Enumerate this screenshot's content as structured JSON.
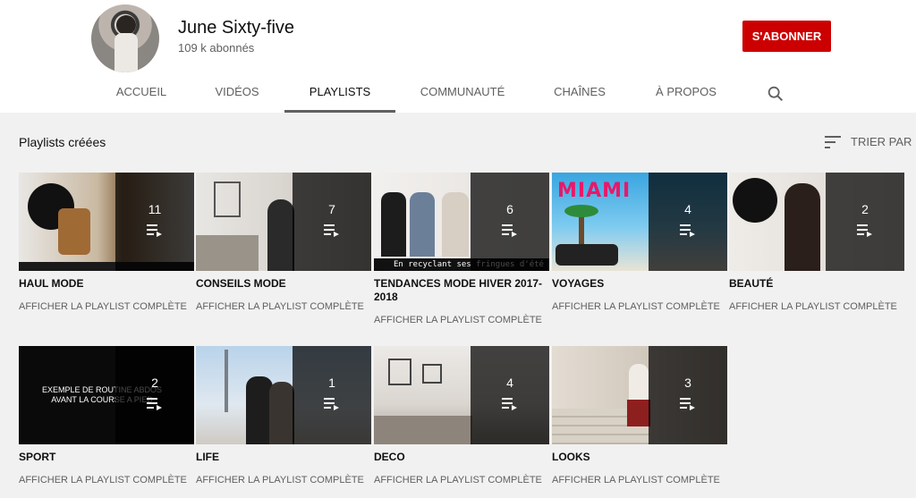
{
  "channel": {
    "name": "June Sixty-five",
    "subscribers": "109 k abonnés",
    "subscribe_label": "S'ABONNER"
  },
  "tabs": [
    {
      "label": "ACCUEIL"
    },
    {
      "label": "VIDÉOS"
    },
    {
      "label": "PLAYLISTS"
    },
    {
      "label": "COMMUNAUTÉ"
    },
    {
      "label": "CHAÎNES"
    },
    {
      "label": "À PROPOS"
    }
  ],
  "active_tab": "PLAYLISTS",
  "section": {
    "title": "Playlists créées",
    "sort_label": "TRIER PAR"
  },
  "playlists": [
    {
      "title": "HAUL MODE",
      "count": "11",
      "link": "AFFICHER LA PLAYLIST COMPLÈTE",
      "thumb_text": ""
    },
    {
      "title": "CONSEILS MODE",
      "count": "7",
      "link": "AFFICHER LA PLAYLIST COMPLÈTE",
      "thumb_text": ""
    },
    {
      "title": "TENDANCES MODE HIVER 2017-2018",
      "count": "6",
      "link": "AFFICHER LA PLAYLIST COMPLÈTE",
      "thumb_text": "En recyclant ses fringues d'été"
    },
    {
      "title": "VOYAGES",
      "count": "4",
      "link": "AFFICHER LA PLAYLIST COMPLÈTE",
      "thumb_text": "MIAMI"
    },
    {
      "title": "BEAUTÉ",
      "count": "2",
      "link": "AFFICHER LA PLAYLIST COMPLÈTE",
      "thumb_text": ""
    },
    {
      "title": "SPORT",
      "count": "2",
      "link": "AFFICHER LA PLAYLIST COMPLÈTE",
      "thumb_text": "EXEMPLE DE ROUTINE ABDOS AVANT LA COURSE A PIED"
    },
    {
      "title": "LIFE",
      "count": "1",
      "link": "AFFICHER LA PLAYLIST COMPLÈTE",
      "thumb_text": ""
    },
    {
      "title": "DECO",
      "count": "4",
      "link": "AFFICHER LA PLAYLIST COMPLÈTE",
      "thumb_text": ""
    },
    {
      "title": "LOOKS",
      "count": "3",
      "link": "AFFICHER LA PLAYLIST COMPLÈTE",
      "thumb_text": ""
    }
  ],
  "icons": {
    "search": "search-icon",
    "sort": "sort-icon",
    "playlist": "playlist-icon"
  },
  "colors": {
    "subscribe": "#cc0000",
    "background": "#f1f1f1",
    "overlay": "rgba(0,0,0,0.72)"
  }
}
